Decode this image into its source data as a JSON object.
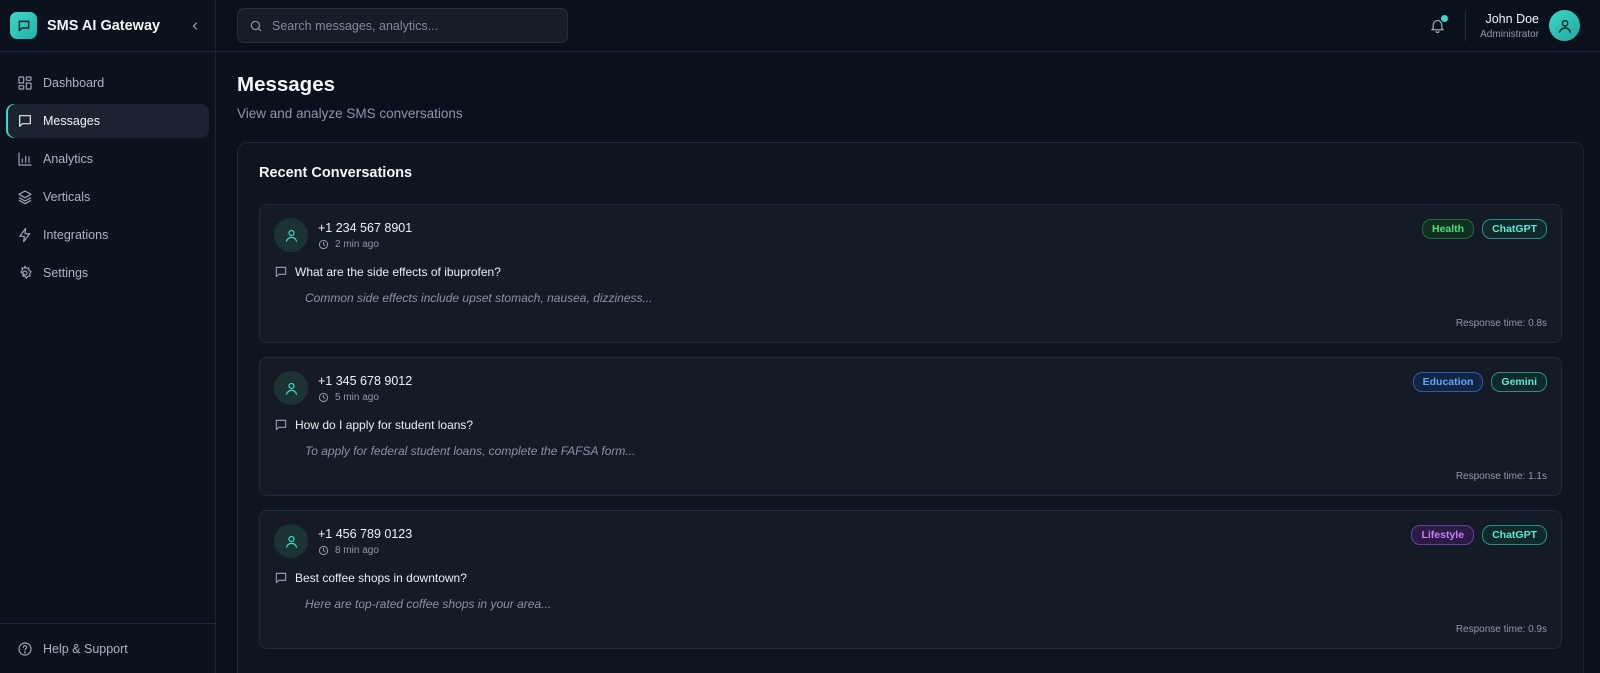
{
  "app": {
    "title": "SMS AI Gateway"
  },
  "sidebar": {
    "items": [
      {
        "label": "Dashboard",
        "icon": "dashboard-icon",
        "active": false
      },
      {
        "label": "Messages",
        "icon": "message-icon",
        "active": true
      },
      {
        "label": "Analytics",
        "icon": "bar-chart-icon",
        "active": false
      },
      {
        "label": "Verticals",
        "icon": "layers-icon",
        "active": false
      },
      {
        "label": "Integrations",
        "icon": "bolt-icon",
        "active": false
      },
      {
        "label": "Settings",
        "icon": "gear-icon",
        "active": false
      }
    ],
    "footer": {
      "label": "Help & Support",
      "icon": "help-circle-icon"
    }
  },
  "topbar": {
    "search_placeholder": "Search messages, analytics...",
    "user": {
      "name": "John Doe",
      "role": "Administrator"
    },
    "notification_dot": true
  },
  "page": {
    "title": "Messages",
    "subtitle": "View and analyze SMS conversations"
  },
  "panel": {
    "title": "Recent Conversations",
    "conversations": [
      {
        "phone": "+1 234 567 8901",
        "time": "2 min ago",
        "question": "What are the side effects of ibuprofen?",
        "answer": "Common side effects include upset stomach, nausea, dizziness...",
        "response_time": "Response time: 0.8s",
        "tags": [
          {
            "label": "Health",
            "color": "#4ade80",
            "bg": "#12301f",
            "border": "#1f6b3e"
          },
          {
            "label": "ChatGPT",
            "color": "#5eead4",
            "bg": "#10292a",
            "border": "#2b8f87"
          }
        ]
      },
      {
        "phone": "+1 345 678 9012",
        "time": "5 min ago",
        "question": "How do I apply for student loans?",
        "answer": "To apply for federal student loans, complete the FAFSA form...",
        "response_time": "Response time: 1.1s",
        "tags": [
          {
            "label": "Education",
            "color": "#60a5fa",
            "bg": "#122542",
            "border": "#2a5da3"
          },
          {
            "label": "Gemini",
            "color": "#5eead4",
            "bg": "#10292a",
            "border": "#2b8f87"
          }
        ]
      },
      {
        "phone": "+1 456 789 0123",
        "time": "8 min ago",
        "question": "Best coffee shops in downtown?",
        "answer": "Here are top-rated coffee shops in your area...",
        "response_time": "Response time: 0.9s",
        "tags": [
          {
            "label": "Lifestyle",
            "color": "#c084fc",
            "bg": "#2d1a45",
            "border": "#6b3fa0"
          },
          {
            "label": "ChatGPT",
            "color": "#5eead4",
            "bg": "#10292a",
            "border": "#2b8f87"
          }
        ]
      }
    ]
  },
  "colors": {
    "accent": "#3fd6c6",
    "background": "#0b111c",
    "card": "#141b27"
  }
}
